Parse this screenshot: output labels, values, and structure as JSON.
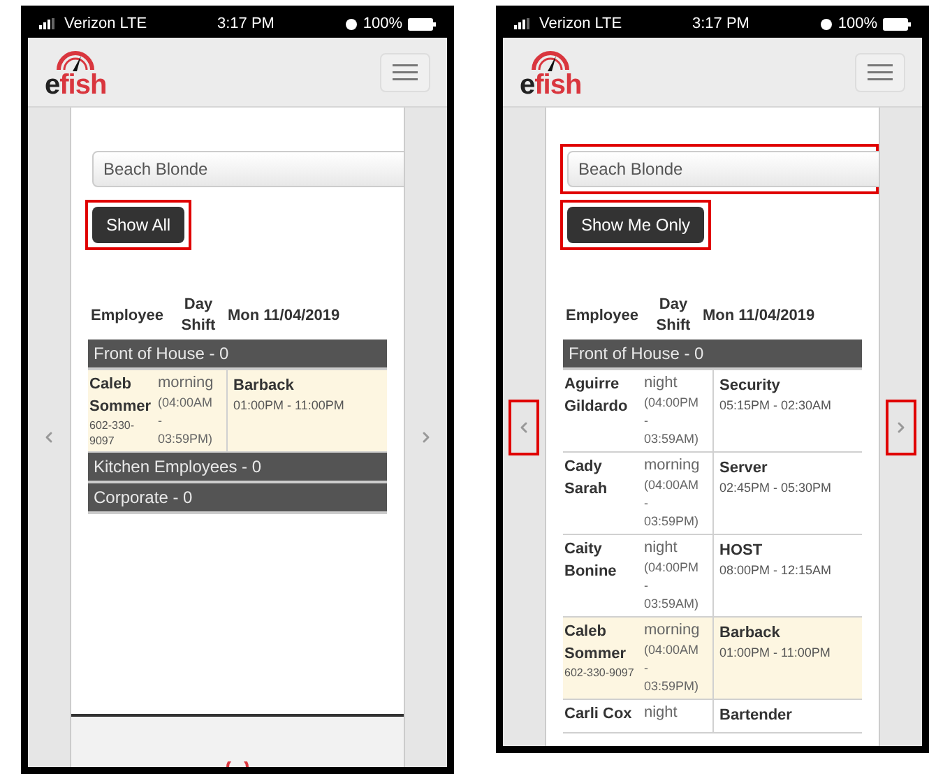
{
  "phones": [
    {
      "status_bar": {
        "carrier": "Verizon LTE",
        "time": "3:17 PM",
        "battery": "100%"
      },
      "logo": "efish",
      "employee_select": {
        "value": "Beach Blonde",
        "highlighted": false
      },
      "filter_button": {
        "label": "Show All",
        "highlighted": true
      },
      "nav_highlighted": false,
      "table": {
        "columns": [
          "Employee",
          "Day Shift",
          "Mon 11/04/2019"
        ],
        "groups": [
          {
            "title": "Front of House - 0",
            "rows": [
              {
                "name": "Caleb Sommer",
                "phone": "602-330-9097",
                "shift": "morning",
                "shift_hours": "(04:00AM - 03:59PM)",
                "position": "Barback",
                "hours": "01:00PM - 11:00PM",
                "highlighted": true
              }
            ]
          },
          {
            "title": "Kitchen Employees - 0"
          },
          {
            "title": "Corporate - 0"
          }
        ]
      },
      "footer": true
    },
    {
      "status_bar": {
        "carrier": "Verizon LTE",
        "time": "3:17 PM",
        "battery": "100%"
      },
      "logo": "efish",
      "employee_select": {
        "value": "Beach Blonde",
        "highlighted": true
      },
      "filter_button": {
        "label": "Show Me Only",
        "highlighted": true
      },
      "nav_highlighted": true,
      "table": {
        "columns": [
          "Employee",
          "Day Shift",
          "Mon 11/04/2019"
        ],
        "groups": [
          {
            "title": "Front of House - 0",
            "rows": [
              {
                "name": "Aguirre Gildardo",
                "shift": "night",
                "shift_hours": "(04:00PM - 03:59AM)",
                "position": "Security",
                "hours": "05:15PM - 02:30AM",
                "highlighted": false
              },
              {
                "name": "Cady Sarah",
                "shift": "morning",
                "shift_hours": "(04:00AM - 03:59PM)",
                "position": "Server",
                "hours": "02:45PM - 05:30PM",
                "highlighted": false
              },
              {
                "name": "Caity Bonine",
                "shift": "night",
                "shift_hours": "(04:00PM - 03:59AM)",
                "position": "HOST",
                "hours": "08:00PM - 12:15AM",
                "highlighted": false
              },
              {
                "name": "Caleb Sommer",
                "phone": "602-330-9097",
                "shift": "morning",
                "shift_hours": "(04:00AM - 03:59PM)",
                "position": "Barback",
                "hours": "01:00PM - 11:00PM",
                "highlighted": true
              },
              {
                "name": "Carli Cox",
                "shift": "night",
                "position": "Bartender",
                "highlighted": false
              }
            ]
          }
        ]
      },
      "footer": false
    }
  ]
}
